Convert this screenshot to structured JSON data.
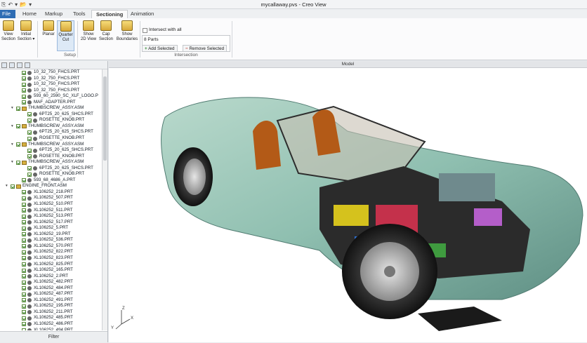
{
  "window": {
    "title": "mycallaway.pvs - Creo View"
  },
  "quick_access": {
    "a": "⎘",
    "b": "↶",
    "c": "▾",
    "d": "📂",
    "e": "▾"
  },
  "tabs": [
    {
      "label": "File ▾"
    },
    {
      "label": "Home"
    },
    {
      "label": "Markup"
    },
    {
      "label": "Tools"
    },
    {
      "label": "Sectioning"
    },
    {
      "label": "Animation"
    }
  ],
  "ribbon": {
    "view_section": "View\nSection",
    "initial_section": "Initial\nSection ▾",
    "planar": "Planar",
    "quarter_cut": "Quarter\nCut",
    "show_2d": "Show\n2D View",
    "cap_section": "Cap\nSection",
    "show_boundaries": "Show\nBoundaries",
    "intersect_with_all": "Intersect with all",
    "parts_count": "8 Parts",
    "add_selected": "Add Selected",
    "remove_selected": "Remove Selected",
    "group_setup": "Setup",
    "group_intersection": "Intersection"
  },
  "tree": [
    {
      "indent": 2,
      "type": "part",
      "label": "10_32_750_FHCS.PRT"
    },
    {
      "indent": 2,
      "type": "part",
      "label": "10_32_750_FHCS.PRT"
    },
    {
      "indent": 2,
      "type": "part",
      "label": "10_32_750_FHCS.PRT"
    },
    {
      "indent": 2,
      "type": "part",
      "label": "10_32_750_FHCS.PRT"
    },
    {
      "indent": 2,
      "type": "part",
      "label": "593_60_2590_SC_XLF_LOGO.P"
    },
    {
      "indent": 2,
      "type": "part",
      "label": "MAF_ADAPTER.PRT"
    },
    {
      "indent": 1,
      "type": "asm",
      "label": "THUMBSCREW_ASSY.ASM"
    },
    {
      "indent": 3,
      "type": "part",
      "label": "6PT25_20_625_SHCS.PRT"
    },
    {
      "indent": 3,
      "type": "part",
      "label": "ROSETTE_KNOB.PRT"
    },
    {
      "indent": 1,
      "type": "asm",
      "label": "THUMBSCREW_ASSY.ASM"
    },
    {
      "indent": 3,
      "type": "part",
      "label": "6PT25_20_625_SHCS.PRT"
    },
    {
      "indent": 3,
      "type": "part",
      "label": "ROSETTE_KNOB.PRT"
    },
    {
      "indent": 1,
      "type": "asm",
      "label": "THUMBSCREW_ASSY.ASM"
    },
    {
      "indent": 3,
      "type": "part",
      "label": "6PT25_20_625_SHCS.PRT"
    },
    {
      "indent": 3,
      "type": "part",
      "label": "ROSETTE_KNOB.PRT"
    },
    {
      "indent": 1,
      "type": "asm",
      "label": "THUMBSCREW_ASSY.ASM"
    },
    {
      "indent": 3,
      "type": "part",
      "label": "6PT25_20_625_SHCS.PRT"
    },
    {
      "indent": 3,
      "type": "part",
      "label": "ROSETTE_KNOB.PRT"
    },
    {
      "indent": 2,
      "type": "part",
      "label": "593_68_4686_A.PRT"
    },
    {
      "indent": 0,
      "type": "asm",
      "label": "ENGINE_FRONT.ASM"
    },
    {
      "indent": 2,
      "type": "part",
      "label": "XL106252_218.PRT"
    },
    {
      "indent": 2,
      "type": "part",
      "label": "XL106252_507.PRT"
    },
    {
      "indent": 2,
      "type": "part",
      "label": "XL106252_510.PRT"
    },
    {
      "indent": 2,
      "type": "part",
      "label": "XL106252_511.PRT"
    },
    {
      "indent": 2,
      "type": "part",
      "label": "XL106252_513.PRT"
    },
    {
      "indent": 2,
      "type": "part",
      "label": "XL106252_517.PRT"
    },
    {
      "indent": 2,
      "type": "part",
      "label": "XL106252_5.PRT"
    },
    {
      "indent": 2,
      "type": "part",
      "label": "XL106252_19.PRT"
    },
    {
      "indent": 2,
      "type": "part",
      "label": "XL106252_536.PRT"
    },
    {
      "indent": 2,
      "type": "part",
      "label": "XL106252_570.PRT"
    },
    {
      "indent": 2,
      "type": "part",
      "label": "XL106252_822.PRT"
    },
    {
      "indent": 2,
      "type": "part",
      "label": "XL106252_823.PRT"
    },
    {
      "indent": 2,
      "type": "part",
      "label": "XL106252_825.PRT"
    },
    {
      "indent": 2,
      "type": "part",
      "label": "XL106252_165.PRT"
    },
    {
      "indent": 2,
      "type": "part",
      "label": "XL106252_2.PRT"
    },
    {
      "indent": 2,
      "type": "part",
      "label": "XL106252_482.PRT"
    },
    {
      "indent": 2,
      "type": "part",
      "label": "XL106252_484.PRT"
    },
    {
      "indent": 2,
      "type": "part",
      "label": "XL106252_487.PRT"
    },
    {
      "indent": 2,
      "type": "part",
      "label": "XL106252_491.PRT"
    },
    {
      "indent": 2,
      "type": "part",
      "label": "XL106252_195.PRT"
    },
    {
      "indent": 2,
      "type": "part",
      "label": "XL106252_211.PRT"
    },
    {
      "indent": 2,
      "type": "part",
      "label": "XL106252_485.PRT"
    },
    {
      "indent": 2,
      "type": "part",
      "label": "XL106252_486.PRT"
    },
    {
      "indent": 2,
      "type": "part",
      "label": "XL106252_494.PRT"
    }
  ],
  "filter_label": "Filter",
  "model_header": "Model",
  "axes": {
    "z": "Z",
    "y": "Y",
    "x": "X"
  },
  "colors": {
    "accent": "#2e6db4",
    "car_body": "#8fbfb0",
    "background": "#ffffff"
  }
}
